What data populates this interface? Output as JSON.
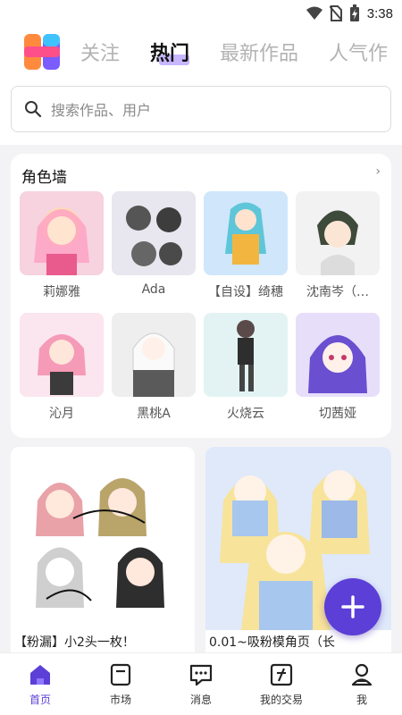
{
  "status": {
    "time": "3:38"
  },
  "tabs": [
    {
      "label": "关注",
      "active": false
    },
    {
      "label": "热门",
      "active": true
    },
    {
      "label": "最新作品",
      "active": false
    },
    {
      "label": "人气作",
      "active": false
    }
  ],
  "search": {
    "placeholder": "搜索作品、用户"
  },
  "role_wall": {
    "title": "角色墙",
    "more": "›",
    "items": [
      {
        "name": "莉娜雅",
        "bg": "#f6d3de"
      },
      {
        "name": "Ada",
        "bg": "#e8e6ee"
      },
      {
        "name": "【自设】绮穗",
        "bg": "#cfe6fb"
      },
      {
        "name": "沈南岑（…",
        "bg": "#f2f2f2"
      },
      {
        "name": "沁月",
        "bg": "#fbe5ee"
      },
      {
        "name": "黑桃A",
        "bg": "#eeeeee"
      },
      {
        "name": "火烧云",
        "bg": "#e3f3f4"
      },
      {
        "name": "切茜娅",
        "bg": "#e7defa"
      }
    ]
  },
  "feed": [
    {
      "title": "【粉漏】小2头一枚！"
    },
    {
      "title": "0.01~吸粉模角页（长"
    }
  ],
  "colors": {
    "accent": "#5b3fd6",
    "tab_highlight": "#c8b6ff"
  },
  "nav": [
    {
      "label": "首页",
      "icon": "home-icon",
      "active": true
    },
    {
      "label": "市场",
      "icon": "market-icon",
      "active": false
    },
    {
      "label": "消息",
      "icon": "message-icon",
      "active": false
    },
    {
      "label": "我的交易",
      "icon": "trade-icon",
      "active": false
    },
    {
      "label": "我",
      "icon": "profile-icon",
      "active": false
    }
  ]
}
